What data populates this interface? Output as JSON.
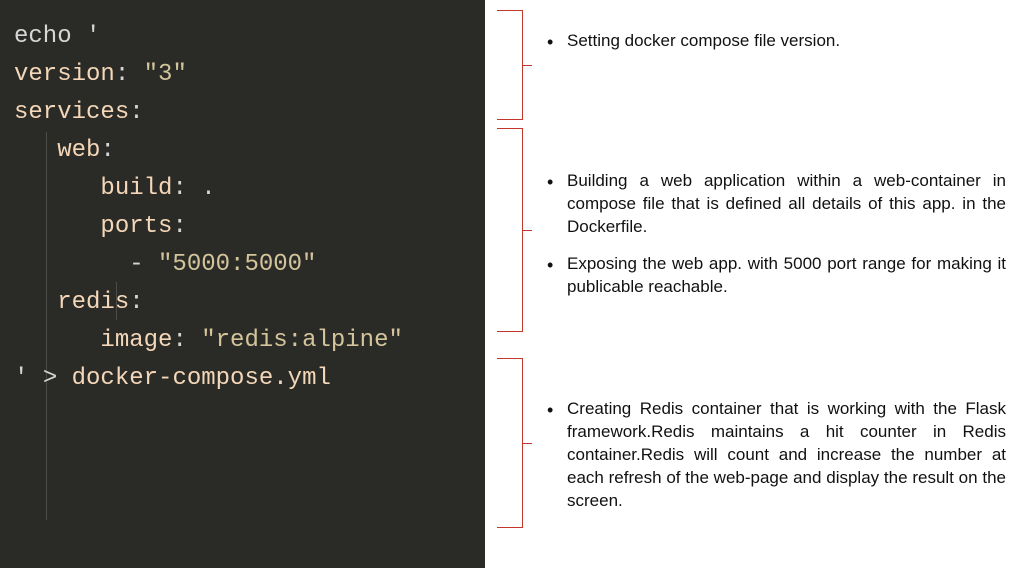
{
  "code": {
    "line1_echo": "echo ",
    "line1_quote": "'",
    "line2_key": "version",
    "line2_colon": ": ",
    "line2_val": "\"3\"",
    "line3_key": "services",
    "line3_colon": ":",
    "line4_indent": "   ",
    "line4_key": "web",
    "line4_colon": ":",
    "line5_indent": "      ",
    "line5_key": "build",
    "line5_colon": ": ",
    "line5_val": ".",
    "line6_indent": "      ",
    "line6_key": "ports",
    "line6_colon": ":",
    "line7_indent": "        ",
    "line7_dash": "- ",
    "line7_val": "\"5000:5000\"",
    "line8_indent": "   ",
    "line8_key": "redis",
    "line8_colon": ":",
    "line9_indent": "      ",
    "line9_key": "image",
    "line9_colon": ": ",
    "line9_val": "\"redis:alpine\"",
    "line10_quote": "' ",
    "line10_redir": "> ",
    "line10_file": "docker-compose.yml"
  },
  "notes": {
    "n1": "Setting  docker compose  file version.",
    "n2": "Building a web application within a web-container in compose file that is defined all details of this app. in the Dockerfile.",
    "n3": "Exposing the web app. with 5000 port range for making it publicable reachable.",
    "n4": "Creating   Redis container that is working with the Flask framework.Redis maintains a hit counter in Redis container.Redis will count and increase the number at each  refresh of the web-page and display the result on the screen."
  }
}
